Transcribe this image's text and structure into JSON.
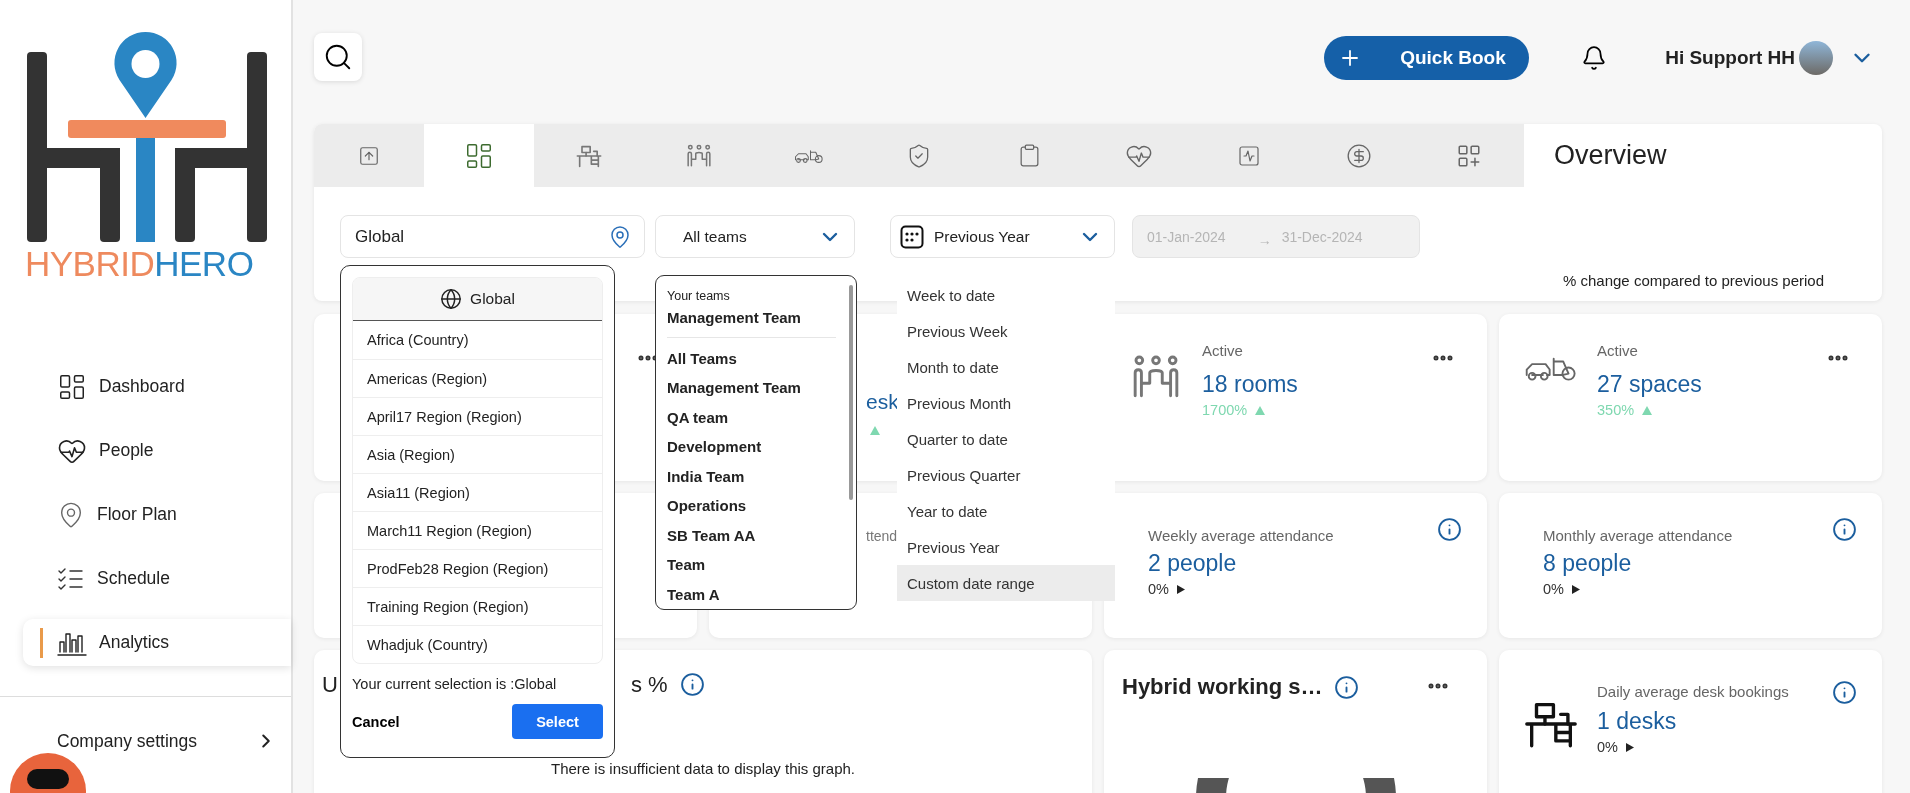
{
  "sidebar": {
    "logo_text": [
      "HYBRID",
      "HERO"
    ],
    "items": [
      {
        "label": "Dashboard",
        "selected": false
      },
      {
        "label": "People",
        "selected": false
      },
      {
        "label": "Floor Plan",
        "selected": false
      },
      {
        "label": "Schedule",
        "selected": false
      },
      {
        "label": "Analytics",
        "selected": true
      }
    ],
    "footer_item": "Company settings"
  },
  "header": {
    "quick_book": "Quick Book",
    "greeting": "Hi Support HH"
  },
  "panel": {
    "tabs": [
      {
        "selected": false
      },
      {
        "selected": true
      },
      {
        "selected": false
      },
      {
        "selected": false
      },
      {
        "selected": false
      },
      {
        "selected": false
      },
      {
        "selected": false
      },
      {
        "selected": false
      },
      {
        "selected": false
      },
      {
        "selected": false
      },
      {
        "selected": false
      }
    ],
    "title": "Overview",
    "filters": {
      "location": "Global",
      "team": "All teams",
      "period": "Previous Year",
      "date_from": "01-Jan-2024",
      "date_separator": "→",
      "date_to": "31-Dec-2024"
    },
    "note": "% change compared to previous period"
  },
  "cards": [
    {
      "kind": "covered",
      "menu": true
    },
    {
      "kind": "covered",
      "value_fragment": "esk",
      "rising": true
    },
    {
      "kind": "stat",
      "label": "Active",
      "value": "18 rooms",
      "change": "1700%",
      "rising": true,
      "menu": true
    },
    {
      "kind": "stat",
      "label": "Active",
      "value": "27 spaces",
      "change": "350%",
      "rising": true,
      "menu": true
    },
    {
      "kind": "covered"
    },
    {
      "kind": "covered",
      "label_fragment": "ttend"
    },
    {
      "kind": "average",
      "label": "Weekly average attendance",
      "value": "2 people",
      "change": "0%",
      "rising": false,
      "info": true
    },
    {
      "kind": "average",
      "label": "Monthly average attendance",
      "value": "8 people",
      "change": "0%",
      "rising": false,
      "info": true
    },
    {
      "kind": "empty_chart",
      "title_start": "U",
      "title_end": "s %",
      "info": true,
      "message": "There is insufficient data to display this graph."
    },
    {
      "kind": "donut",
      "title": "Hybrid working s…",
      "info": true,
      "menu": true
    },
    {
      "kind": "stat",
      "label": "Daily average desk bookings",
      "value": "1 desks",
      "change": "0%",
      "rising": false,
      "info": true
    }
  ],
  "location_menu": {
    "header": "Global",
    "items": [
      "Africa (Country)",
      "Americas (Region)",
      "April17 Region (Region)",
      "Asia (Region)",
      "Asia11 (Region)",
      "March11 Region (Region)",
      "ProdFeb28 Region (Region)",
      "Training Region (Region)",
      "Whadjuk (Country)"
    ],
    "selection_text": "Your current selection is :Global",
    "cancel": "Cancel",
    "select": "Select"
  },
  "team_menu": {
    "section_label": "Your teams",
    "your_teams": [
      "Management Team"
    ],
    "items": [
      "All Teams",
      "Management Team",
      "QA team",
      "Development",
      "India Team",
      "Operations",
      "SB Team AA",
      "Team",
      "Team A"
    ]
  },
  "period_menu": {
    "items": [
      {
        "label": "Week to date",
        "hovered": false
      },
      {
        "label": "Previous Week",
        "hovered": false
      },
      {
        "label": "Month to date",
        "hovered": false
      },
      {
        "label": "Previous Month",
        "hovered": false
      },
      {
        "label": "Quarter to date",
        "hovered": false
      },
      {
        "label": "Previous Quarter",
        "hovered": false
      },
      {
        "label": "Year to date",
        "hovered": false
      },
      {
        "label": "Previous Year",
        "hovered": false
      },
      {
        "label": "Custom date range",
        "hovered": true
      }
    ]
  }
}
